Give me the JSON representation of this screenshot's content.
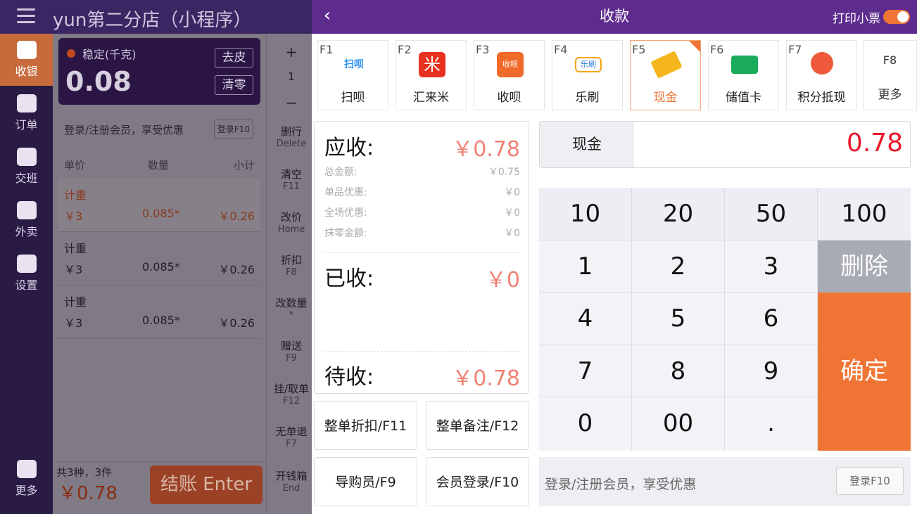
{
  "topbar": {
    "store_title": "yun第二分店（小程序）"
  },
  "nav": {
    "items": [
      {
        "label": "收银"
      },
      {
        "label": "订单"
      },
      {
        "label": "交班"
      },
      {
        "label": "外卖"
      },
      {
        "label": "设置"
      },
      {
        "label": "更多"
      }
    ]
  },
  "scale": {
    "label": "稳定(千克)",
    "value": "0.08",
    "tare_label": "去皮",
    "zero_label": "清零"
  },
  "cart": {
    "member_prompt": "登录/注册会员，享受优惠",
    "member_button": "登录F10",
    "headers": {
      "price": "单价",
      "qty": "数量",
      "subtotal": "小计"
    },
    "rows": [
      {
        "name": "计重",
        "price": "￥3",
        "qty": "0.085*",
        "subtotal": "￥0.26"
      },
      {
        "name": "计重",
        "price": "￥3",
        "qty": "0.085*",
        "subtotal": "￥0.26"
      },
      {
        "name": "计重",
        "price": "￥3",
        "qty": "0.085*",
        "subtotal": "￥0.26"
      }
    ],
    "count": "共3种，3件",
    "total": "￥0.78",
    "checkout_label": "结账 Enter"
  },
  "ops": {
    "plus": "+",
    "qty": "1",
    "minus": "−",
    "items": [
      {
        "label": "删行",
        "key": "Delete"
      },
      {
        "label": "清空",
        "key": "F11"
      },
      {
        "label": "改价",
        "key": "Home"
      },
      {
        "label": "折扣",
        "key": "F8"
      },
      {
        "label": "改数量",
        "key": "*"
      },
      {
        "label": "赠送",
        "key": "F9"
      },
      {
        "label": "挂/取单",
        "key": "F12"
      },
      {
        "label": "无单退",
        "key": "F7"
      },
      {
        "label": "开钱箱",
        "key": "End"
      }
    ]
  },
  "dialog": {
    "title": "收款",
    "print_receipt_label": "打印小票",
    "print_receipt_on": true,
    "methods": [
      {
        "key": "F1",
        "label": "扫呗",
        "icon": "saobei-icon",
        "color": "#2c8ff0"
      },
      {
        "key": "F2",
        "label": "汇来米",
        "icon": "huilaimi-icon",
        "color": "#e8301e"
      },
      {
        "key": "F3",
        "label": "收呗",
        "icon": "shoubei-icon",
        "color": "#f06a2a"
      },
      {
        "key": "F4",
        "label": "乐刷",
        "icon": "leshua-icon",
        "color": "#f2a516"
      },
      {
        "key": "F5",
        "label": "现金",
        "icon": "cash-icon",
        "color": "#f5b51c"
      },
      {
        "key": "F6",
        "label": "储值卡",
        "icon": "stored-card-icon",
        "color": "#1aac5c"
      },
      {
        "key": "F7",
        "label": "积分抵现",
        "icon": "points-icon",
        "color": "#ef5a3c"
      }
    ],
    "selected_method": "现金",
    "more": {
      "key": "F8",
      "label": "更多"
    },
    "summary": {
      "receivable_label": "应收:",
      "receivable": "￥0.78",
      "details": [
        {
          "label": "总金额:",
          "value": "￥0.75"
        },
        {
          "label": "单品优惠:",
          "value": "￥0"
        },
        {
          "label": "全场优惠:",
          "value": "￥0"
        },
        {
          "label": "抹零金额:",
          "value": "￥0"
        }
      ],
      "received_label": "已收:",
      "received": "￥0",
      "pending_label": "待收:",
      "pending": "￥0.78"
    },
    "actions": [
      {
        "label": "整单折扣/F11"
      },
      {
        "label": "整单备注/F12"
      },
      {
        "label": "导购员/F9"
      },
      {
        "label": "会员登录/F10"
      }
    ],
    "method_box": {
      "name": "现金",
      "amount": "0.78"
    },
    "keypad": {
      "quick": [
        "10",
        "20",
        "50",
        "100"
      ],
      "rows": [
        [
          "1",
          "2",
          "3"
        ],
        [
          "4",
          "5",
          "6"
        ],
        [
          "7",
          "8",
          "9"
        ],
        [
          "0",
          "00",
          "."
        ]
      ],
      "delete_label": "删除",
      "confirm_label": "确定"
    },
    "member": {
      "prompt": "登录/注册会员，享受优惠",
      "button": "登录F10"
    }
  }
}
